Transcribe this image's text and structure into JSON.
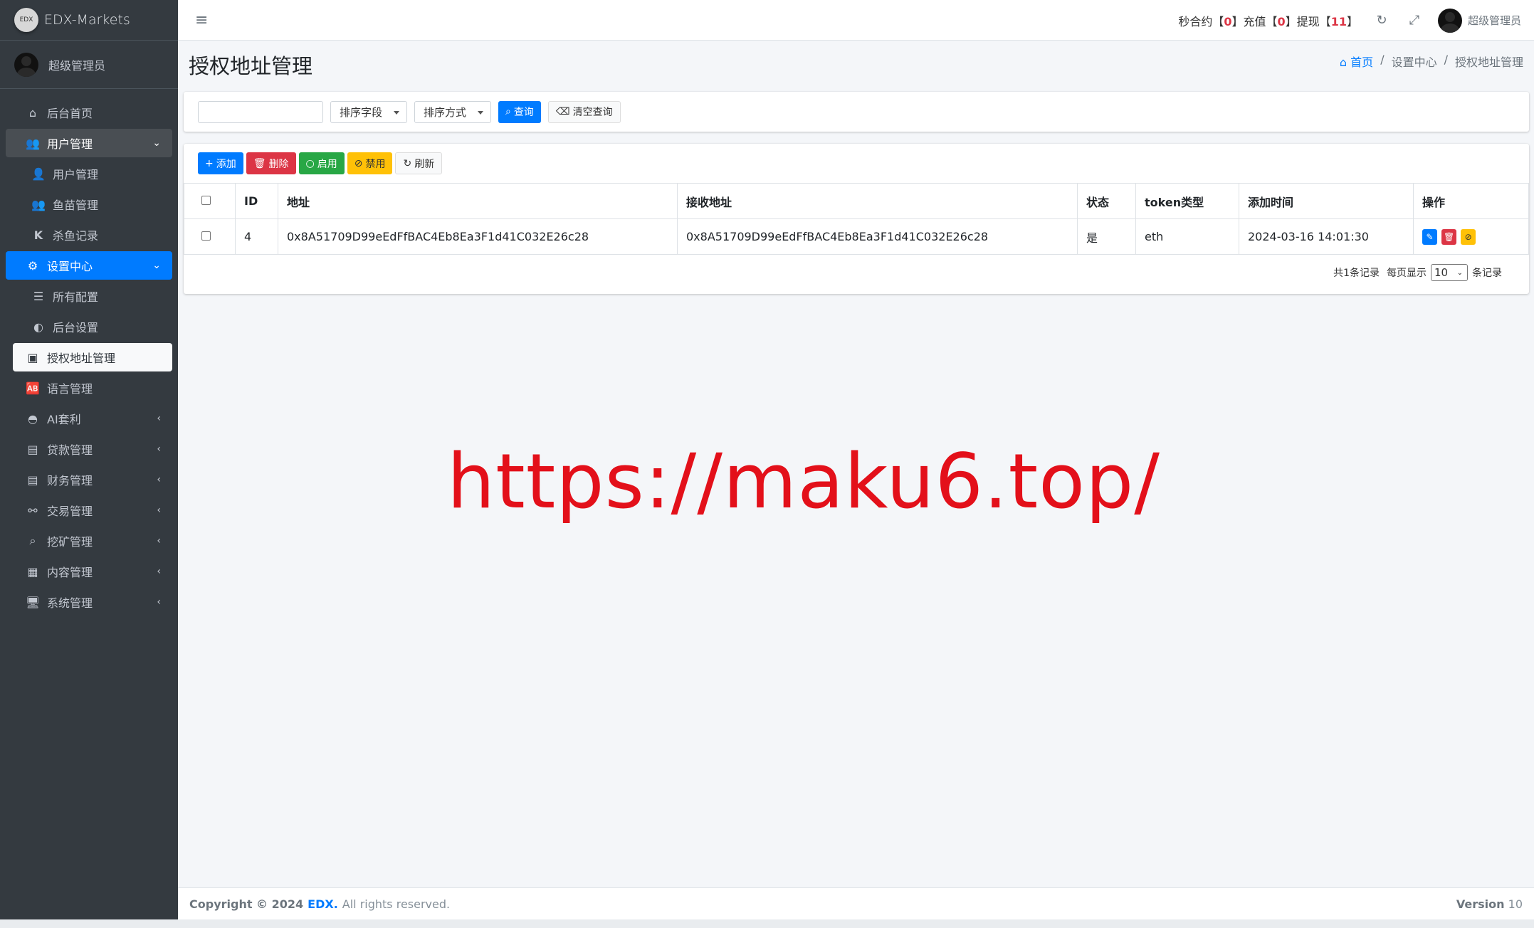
{
  "app": {
    "brand_logo_text": "EDX",
    "brand_name": "EDX-Markets",
    "user_name": "超级管理员"
  },
  "topbar": {
    "stats_prefix1": "秒合约【",
    "stats_val1": "0",
    "stats_mid1": "】充值【",
    "stats_val2": "0",
    "stats_mid2": "】提现【",
    "stats_val3": "11",
    "stats_suffix": "】",
    "admin_name": "超级管理员"
  },
  "sidebar": {
    "items": [
      {
        "label": "后台首页",
        "icon": "home-icon"
      },
      {
        "label": "用户管理",
        "icon": "users-icon"
      },
      {
        "label": "用户管理",
        "icon": "user-icon"
      },
      {
        "label": "鱼苗管理",
        "icon": "users-icon"
      },
      {
        "label": "杀鱼记录",
        "icon": "k-icon"
      },
      {
        "label": "设置中心",
        "icon": "cogs-icon"
      },
      {
        "label": "所有配置",
        "icon": "list-icon"
      },
      {
        "label": "后台设置",
        "icon": "adjust-icon"
      },
      {
        "label": "授权地址管理",
        "icon": "id-card-icon"
      },
      {
        "label": "语言管理",
        "icon": "language-icon"
      },
      {
        "label": "AI套利",
        "icon": "android-icon"
      },
      {
        "label": "贷款管理",
        "icon": "money-icon"
      },
      {
        "label": "财务管理",
        "icon": "money-icon"
      },
      {
        "label": "交易管理",
        "icon": "exchange-icon"
      },
      {
        "label": "挖矿管理",
        "icon": "search-icon"
      },
      {
        "label": "内容管理",
        "icon": "newspaper-icon"
      },
      {
        "label": "系统管理",
        "icon": "desktop-icon"
      }
    ]
  },
  "page": {
    "title": "授权地址管理",
    "breadcrumb": {
      "home": "首页",
      "parent": "设置中心",
      "current": "授权地址管理",
      "separator": "/"
    }
  },
  "search": {
    "input_value": "",
    "sort_field": "排序字段",
    "sort_order": "排序方式",
    "query_label": "查询",
    "clear_label": "清空查询"
  },
  "toolbar": {
    "add": "添加",
    "delete": "删除",
    "enable": "启用",
    "disable": "禁用",
    "refresh": "刷新"
  },
  "table": {
    "columns": [
      "ID",
      "地址",
      "接收地址",
      "状态",
      "token类型",
      "添加时间",
      "操作"
    ],
    "rows": [
      {
        "id": "4",
        "address": "0x8A51709D99eEdFfBAC4Eb8Ea3F1d41C032E26c28",
        "receive": "0x8A51709D99eEdFfBAC4Eb8Ea3F1d41C032E26c28",
        "status": "是",
        "token": "eth",
        "time": "2024-03-16 14:01:30"
      }
    ]
  },
  "pagination": {
    "total": "共1条记录",
    "per_page_label": "每页显示",
    "page_size": "10",
    "records_label": "条记录"
  },
  "watermark": "https://maku6.top/",
  "footer": {
    "copyright": "Copyright © 2024",
    "brand": "EDX.",
    "rights": "All rights reserved.",
    "version_label": "Version",
    "version_value": "10"
  },
  "colors": {
    "sidebar_bg": "#343a40",
    "primary": "#007bff",
    "danger": "#dc3545",
    "success": "#28a745",
    "warning": "#ffc107",
    "watermark": "#e3101a"
  }
}
